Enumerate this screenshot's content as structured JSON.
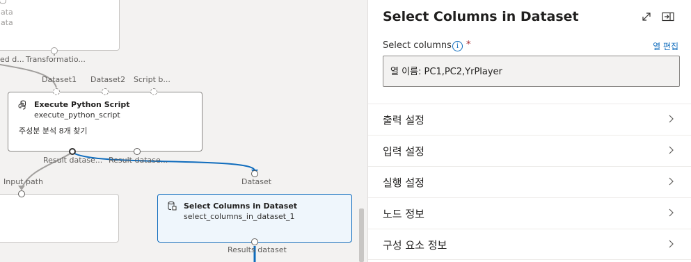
{
  "canvas": {
    "top_node": {
      "line1": "ata",
      "line2": "ata"
    },
    "top_ports": {
      "left": "ed d...",
      "right": "Transformatio..."
    },
    "exec_ports": {
      "p1": "Dataset1",
      "p2": "Dataset2",
      "p3": "Script b..."
    },
    "exec_node": {
      "title": "Execute Python Script",
      "subtitle": "execute_python_script",
      "description": "주성분 분석 8개 찾기"
    },
    "exec_out_ports": {
      "p1": "Result datase...",
      "p2": "Result datase..."
    },
    "left_node_port": "Input path",
    "select_in_port": "Dataset",
    "select_node": {
      "title": "Select Columns in Dataset",
      "subtitle": "select_columns_in_dataset_1"
    },
    "select_out_port": "Results dataset"
  },
  "panel": {
    "title": "Select Columns in Dataset",
    "field_label": "Select columns",
    "info_glyph": "i",
    "required_mark": "*",
    "edit_link": "열 편집",
    "columns_value": "열 이름: PC1,PC2,YrPlayer",
    "sections": [
      {
        "label": "출력 설정"
      },
      {
        "label": "입력 설정"
      },
      {
        "label": "실행 설정"
      },
      {
        "label": "노드 정보"
      },
      {
        "label": "구성 요소 정보"
      }
    ]
  },
  "colors": {
    "accent": "#0f6cbd",
    "edge": "#a19f9d",
    "selected_bg": "#eff6fc"
  },
  "icons": [
    "python-icon",
    "dataset-icon",
    "expand-icon",
    "collapse-panel-icon",
    "info-icon",
    "chevron-right-icon"
  ]
}
